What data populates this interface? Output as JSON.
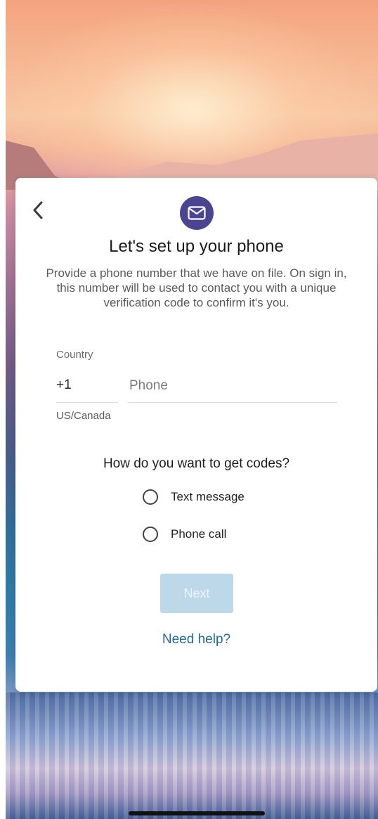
{
  "colors": {
    "accent": "#4b4591",
    "link": "#1e6a99",
    "button_disabled_bg": "#bdd9e9"
  },
  "header": {
    "back_icon": "chevron-left-icon",
    "badge_icon": "envelope-icon"
  },
  "main": {
    "title": "Let's set up your phone",
    "description": "Provide a phone number that we have on file. On sign in, this number will be used to contact you with a unique verification code to confirm it's you."
  },
  "form": {
    "country_label": "Country",
    "country_code": "+1",
    "country_name": "US/Canada",
    "phone_placeholder": "Phone",
    "phone_value": ""
  },
  "delivery": {
    "question": "How do you want to get codes?",
    "options": [
      {
        "label": "Text message",
        "selected": false
      },
      {
        "label": "Phone call",
        "selected": false
      }
    ]
  },
  "actions": {
    "next_label": "Next",
    "next_enabled": false,
    "help_label": "Need help?"
  }
}
